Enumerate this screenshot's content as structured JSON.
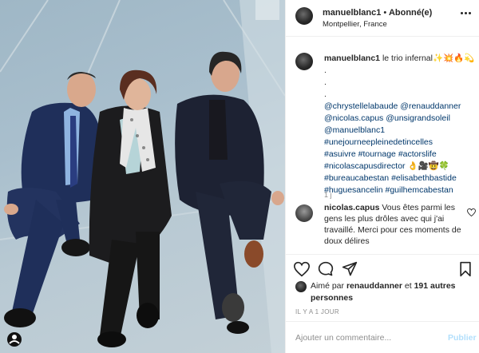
{
  "photo": {
    "alt": ""
  },
  "header": {
    "username": "manuelblanc1",
    "dot": "•",
    "follow_label": "Abonné(e)",
    "location": "Montpellier, France"
  },
  "caption": {
    "username": "manuelblanc1",
    "text": "le trio infernal✨💥🔥💫",
    "dots": [
      ".",
      ".",
      "."
    ],
    "tags": [
      "@chrystellelabaude @renauddanner",
      "@nicolas.capus @unsigrandsoleil",
      "@manuelblanc1",
      "#unejourneepleinedetincelles",
      "#asuivre #tournage #actorslife",
      "#nicolascapusdirector 👌🎥🤠🍀",
      "#bureaucabestan #elisabethbastide",
      "#huguesancelin #guilhemcabestan"
    ],
    "time": "1 j"
  },
  "comment": {
    "username": "nicolas.capus",
    "text": "Vous êtes parmi les gens les plus drôles avec qui j'ai travaillé. Merci pour ces moments de doux délires"
  },
  "likes": {
    "prefix": "Aimé par",
    "liker": "renauddanner",
    "conj": "et",
    "others": "191 autres personnes"
  },
  "timestamp": "IL Y A 1 JOUR",
  "comment_box": {
    "placeholder": "Ajouter un commentaire...",
    "post_label": "Publier"
  },
  "icons": {
    "heart": "heart-icon",
    "comment": "comment-icon",
    "share": "share-icon",
    "save": "bookmark-icon",
    "more": "more-icon"
  },
  "colors": {
    "link": "#00376b",
    "muted": "#8e8e8e",
    "post_disabled": "#b2dffc"
  }
}
